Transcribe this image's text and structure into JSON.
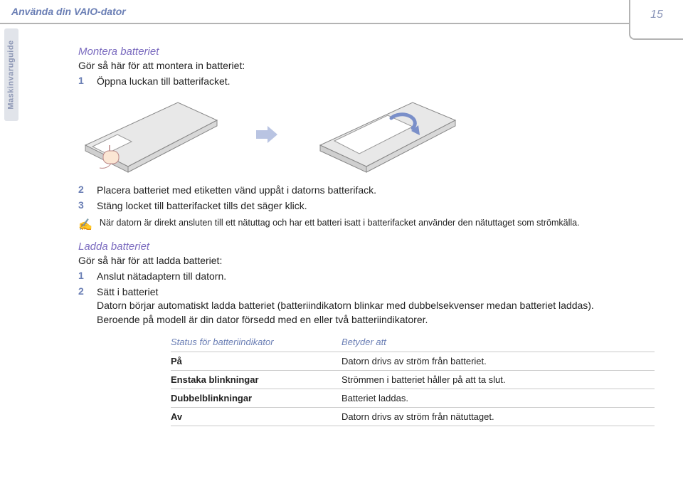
{
  "header": {
    "title": "Använda din VAIO-dator"
  },
  "sidebar": {
    "label": "Maskinvaruguide"
  },
  "page_number": "15",
  "section_mount": {
    "heading": "Montera batteriet",
    "intro": "Gör så här för att montera in batteriet:",
    "steps": [
      "Öppna luckan till batterifacket.",
      "Placera batteriet med etiketten vänd uppåt i datorns batterifack.",
      "Stäng locket till batterifacket tills det säger klick."
    ],
    "note": "När datorn är direkt ansluten till ett nätuttag och har ett batteri isatt i batterifacket använder den nätuttaget som strömkälla."
  },
  "section_charge": {
    "heading": "Ladda batteriet",
    "intro": "Gör så här för att ladda batteriet:",
    "steps": [
      {
        "label": "Anslut nätadaptern till datorn."
      },
      {
        "label": "Sätt i batteriet",
        "detail1": "Datorn börjar automatiskt ladda batteriet (batteriindikatorn blinkar med dubbelsekvenser medan batteriet laddas).",
        "detail2": "Beroende på modell är din dator försedd med en eller två batteriindikatorer."
      }
    ]
  },
  "table": {
    "headers": {
      "c1": "Status för batteriindikator",
      "c2": "Betyder att"
    },
    "rows": [
      {
        "c1": "På",
        "c2": "Datorn drivs av ström från batteriet."
      },
      {
        "c1": "Enstaka blinkningar",
        "c2": "Strömmen i batteriet håller på att ta slut."
      },
      {
        "c1": "Dubbelblinkningar",
        "c2": "Batteriet laddas."
      },
      {
        "c1": "Av",
        "c2": "Datorn drivs av ström från nätuttaget."
      }
    ]
  }
}
